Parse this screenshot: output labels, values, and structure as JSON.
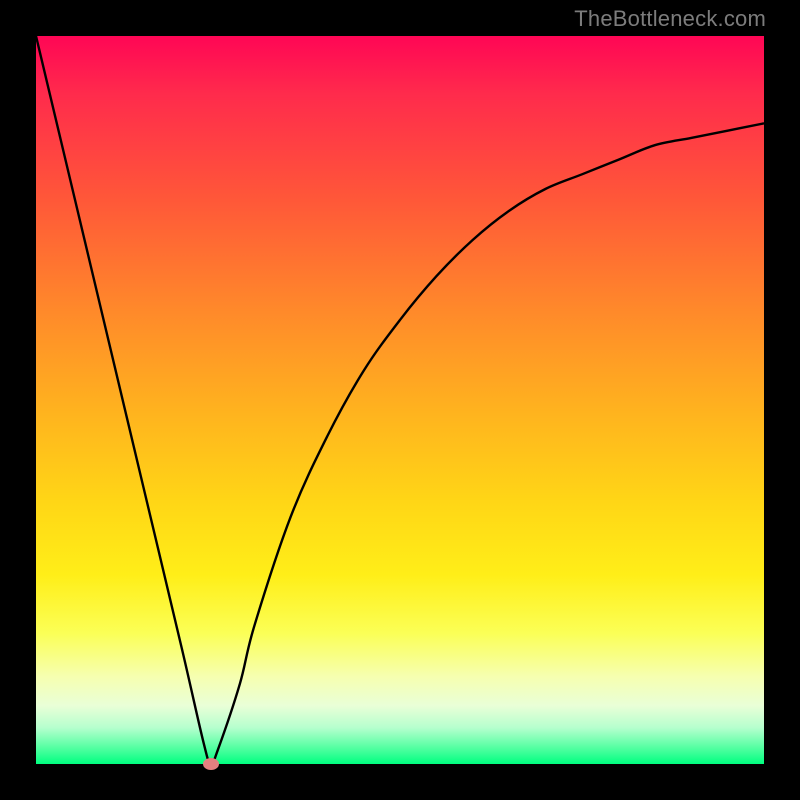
{
  "watermark": "TheBottleneck.com",
  "colors": {
    "frame": "#000000",
    "curve": "#000000",
    "marker": "#e48080"
  },
  "chart_data": {
    "type": "line",
    "title": "",
    "xlabel": "",
    "ylabel": "",
    "xlim": [
      0,
      100
    ],
    "ylim": [
      0,
      100
    ],
    "grid": false,
    "legend": false,
    "notes": "Axes and ticks are not labeled in the image; x/y units unknown. Values estimated from pixel positions. y=0 at bottom (green), y=100 at top (red).",
    "series": [
      {
        "name": "curve",
        "x": [
          0,
          5,
          10,
          15,
          20,
          23,
          24,
          25,
          28,
          30,
          35,
          40,
          45,
          50,
          55,
          60,
          65,
          70,
          75,
          80,
          85,
          90,
          95,
          100
        ],
        "y": [
          100,
          79,
          58,
          37,
          16,
          3,
          0,
          2,
          11,
          19,
          34,
          45,
          54,
          61,
          67,
          72,
          76,
          79,
          81,
          83,
          85,
          86,
          87,
          88
        ]
      }
    ],
    "markers": [
      {
        "name": "min-point",
        "x": 24,
        "y": 0
      }
    ]
  }
}
